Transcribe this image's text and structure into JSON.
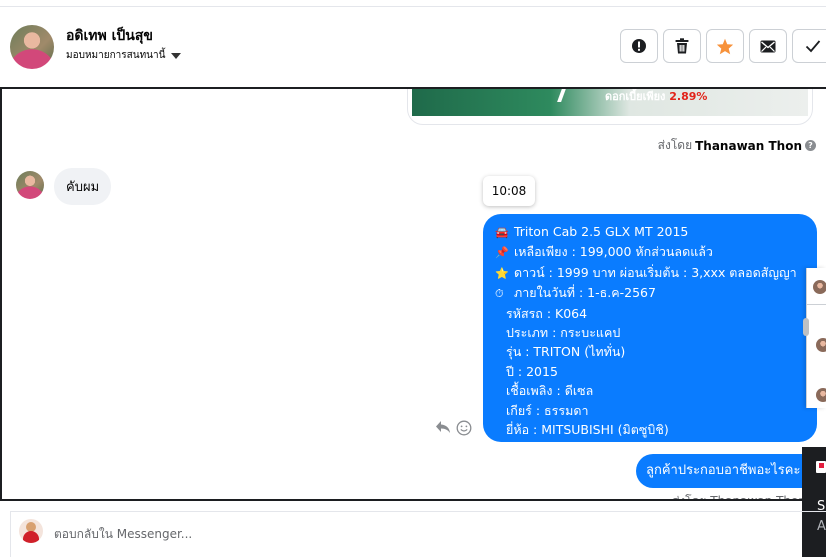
{
  "contact": {
    "name": "อดิเทพ เป็นสุข",
    "assign_label": "มอบหมายการสนทนานี้"
  },
  "toolbar": {
    "buttons": [
      {
        "name": "mark-spam",
        "icon": "alert-icon"
      },
      {
        "name": "delete",
        "icon": "trash-icon"
      },
      {
        "name": "follow-up",
        "icon": "star-icon",
        "color": "#f7923b"
      },
      {
        "name": "mark-unread",
        "icon": "envelope-icon"
      },
      {
        "name": "mark-done",
        "icon": "check-icon"
      }
    ]
  },
  "image_card": {
    "promo_text": "ดอกเบี้ยเพียง ",
    "promo_rate": "2.89%"
  },
  "messages": {
    "sent_by_prefix": "ส่งโดย",
    "agent_name": "Thanawan Thon",
    "incoming_1": "คับผม",
    "timestamp": "10:08",
    "listing": {
      "emoji_1": "🚘",
      "line_1": "Triton Cab 2.5 GLX MT 2015",
      "emoji_2": "📌",
      "line_2": "เหลือเพียง : 199,000 หักส่วนลดแล้ว",
      "emoji_3": "⭐",
      "line_3": "ดาวน์ : 1999 บาท ผ่อนเริ่มต้น : 3,xxx ตลอดสัญญา",
      "emoji_4": "⏱",
      "line_4": "ภายในวันที่ : 1-ธ.ค-2567",
      "line_5": "รหัสรถ : K064",
      "line_6": "ประเภท : กระบะแคป",
      "line_7": "รุ่น : TRITON (ไททั่น)",
      "line_8": "ปี : 2015",
      "line_9": "เชื้อเพลิง : ดีเซล",
      "line_10": "เกียร์ : ธรรมดา",
      "line_11": "ยี่ห้อ : MITSUBISHI (มิตซูบิชิ)"
    },
    "outgoing_2": "ลูกค้าประกอบอาชีพอะไรคะ",
    "sent_by_2": "ส่งโดย Thanawan Thon"
  },
  "side_panel": {
    "title_initial": "S",
    "subtitle_initial": "A"
  },
  "composer": {
    "placeholder": "ตอบกลับใน Messenger..."
  }
}
